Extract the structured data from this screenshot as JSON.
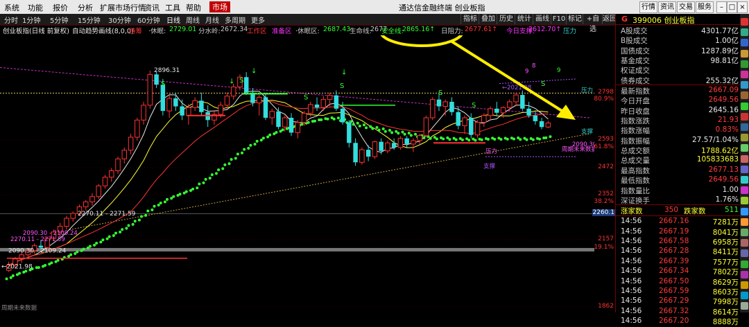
{
  "menu": {
    "items": [
      "系统",
      "功能",
      "报价",
      "分析",
      "扩展市场行情",
      "资讯",
      "工具",
      "帮助"
    ],
    "active": "市场",
    "title": "通达信金融终端  创业板指",
    "right": [
      "行情",
      "资讯",
      "交易",
      "服务"
    ]
  },
  "periods": [
    "分时",
    "1分钟",
    "5分钟",
    "15分钟",
    "30分钟",
    "60分钟",
    "日线",
    "周线",
    "月线",
    "多周期",
    "更多"
  ],
  "selected_period": "日线",
  "toolbar_right": [
    "指标",
    "叠加",
    "历史",
    "统计",
    "画线",
    "F10",
    "标记",
    "+自选",
    "返回"
  ],
  "legend": {
    "name": "创业板指(日线 前复权)",
    "auto": "自动趋势画线(8,0,0)",
    "items": [
      {
        "t": "持筹",
        "c": "#ff3333"
      },
      {
        "t": "·休眠:",
        "c": "#c8c8c8"
      },
      {
        "t": "2729.01",
        "c": "#33ff33"
      },
      {
        "t": "分水岭:",
        "c": "#c8c8c8"
      },
      {
        "t": "2672.34",
        "c": "#c8c8c8"
      },
      {
        "t": "工作区",
        "c": "#ff3333"
      },
      {
        "t": "准备区",
        "c": "#ff33ff"
      },
      {
        "t": "·休眠区:",
        "c": "#c8c8c8"
      },
      {
        "t": "2687.43",
        "c": "#33ff33"
      },
      {
        "t": "生命线:",
        "c": "#c8c8c8"
      },
      {
        "t": "2677",
        "c": "#c8c8c8"
      },
      {
        "t": "安全线:",
        "c": "#33ff33"
      },
      {
        "t": "2865.16↑",
        "c": "#33ff33"
      },
      {
        "t": "日阻力:",
        "c": "#c8c8c8"
      },
      {
        "t": "2677.61↑",
        "c": "#ff3333"
      },
      {
        "t": "今日支撑:",
        "c": "#ff33ff"
      },
      {
        "t": "2612.70↑",
        "c": "#ff33ff"
      },
      {
        "t": "压力",
        "c": "#33cccc"
      }
    ]
  },
  "chart_data": {
    "type": "candlestick",
    "ylim": [
      1862,
      2960
    ],
    "ticks": [
      2798,
      2593,
      2472,
      2352,
      2157,
      1862
    ],
    "pct_ticks": [
      "80.9%",
      "61.8%",
      "38.2%",
      "19.1%"
    ],
    "annotations": [
      "2896.31",
      "2270.11 - 2271.59",
      "2090.30 - 2109.24",
      "←2021.98",
      "2260.1",
      "周期未来数据",
      "压力",
      "支撑",
      "8",
      "9",
      "7",
      "5",
      "6",
      "3",
      "2",
      "1"
    ],
    "ohlc": [
      [
        2021.98,
        2060,
        2015,
        2045
      ],
      [
        2045,
        2080,
        2030,
        2072
      ],
      [
        2072,
        2100,
        2055,
        2090
      ],
      [
        2090,
        2118,
        2070,
        2108
      ],
      [
        2108,
        2140,
        2095,
        2130
      ],
      [
        2130,
        2155,
        2110,
        2122
      ],
      [
        2122,
        2170,
        2115,
        2162
      ],
      [
        2162,
        2200,
        2150,
        2190
      ],
      [
        2190,
        2230,
        2170,
        2215
      ],
      [
        2215,
        2260,
        2200,
        2250
      ],
      [
        2250,
        2280,
        2235,
        2271.59
      ],
      [
        2271,
        2310,
        2260,
        2300
      ],
      [
        2300,
        2330,
        2285,
        2322
      ],
      [
        2322,
        2360,
        2305,
        2345
      ],
      [
        2345,
        2400,
        2335,
        2392
      ],
      [
        2392,
        2440,
        2380,
        2430
      ],
      [
        2430,
        2470,
        2410,
        2458
      ],
      [
        2458,
        2520,
        2445,
        2510
      ],
      [
        2510,
        2560,
        2490,
        2548
      ],
      [
        2548,
        2620,
        2530,
        2605
      ],
      [
        2605,
        2690,
        2590,
        2680
      ],
      [
        2680,
        2760,
        2660,
        2745
      ],
      [
        2745,
        2896.31,
        2730,
        2880
      ],
      [
        2880,
        2890,
        2820,
        2835
      ],
      [
        2835,
        2860,
        2700,
        2720
      ],
      [
        2720,
        2790,
        2690,
        2775
      ],
      [
        2775,
        2800,
        2720,
        2740
      ],
      [
        2740,
        2770,
        2680,
        2700
      ],
      [
        2700,
        2750,
        2660,
        2735
      ],
      [
        2735,
        2780,
        2720,
        2765
      ],
      [
        2765,
        2800,
        2700,
        2715
      ],
      [
        2715,
        2745,
        2650,
        2680
      ],
      [
        2680,
        2720,
        2660,
        2705
      ],
      [
        2705,
        2760,
        2690,
        2745
      ],
      [
        2745,
        2800,
        2730,
        2785
      ],
      [
        2785,
        2840,
        2770,
        2825
      ],
      [
        2825,
        2880,
        2810,
        2868
      ],
      [
        2868,
        2890,
        2790,
        2800
      ],
      [
        2800,
        2820,
        2740,
        2755
      ],
      [
        2755,
        2790,
        2700,
        2780
      ],
      [
        2780,
        2800,
        2680,
        2690
      ],
      [
        2690,
        2730,
        2660,
        2718
      ],
      [
        2718,
        2735,
        2640,
        2650
      ],
      [
        2650,
        2700,
        2630,
        2690
      ],
      [
        2690,
        2710,
        2610,
        2625
      ],
      [
        2625,
        2680,
        2600,
        2670
      ],
      [
        2670,
        2720,
        2655,
        2710
      ],
      [
        2710,
        2760,
        2695,
        2748
      ],
      [
        2748,
        2780,
        2720,
        2735
      ],
      [
        2735,
        2785,
        2720,
        2770
      ],
      [
        2770,
        2800,
        2740,
        2788
      ],
      [
        2788,
        2810,
        2720,
        2730
      ],
      [
        2730,
        2760,
        2660,
        2670
      ],
      [
        2670,
        2680,
        2560,
        2580
      ],
      [
        2580,
        2600,
        2480,
        2495
      ],
      [
        2495,
        2560,
        2485,
        2550
      ],
      [
        2550,
        2570,
        2500,
        2520
      ],
      [
        2520,
        2590,
        2510,
        2585
      ],
      [
        2585,
        2600,
        2530,
        2545
      ],
      [
        2545,
        2590,
        2535,
        2580
      ],
      [
        2580,
        2600,
        2550,
        2560
      ],
      [
        2560,
        2610,
        2550,
        2600
      ],
      [
        2600,
        2610,
        2560,
        2575
      ],
      [
        2575,
        2600,
        2540,
        2590
      ],
      [
        2590,
        2620,
        2575,
        2612
      ],
      [
        2612,
        2700,
        2605,
        2690
      ],
      [
        2690,
        2780,
        2680,
        2770
      ],
      [
        2770,
        2800,
        2720,
        2740
      ],
      [
        2740,
        2770,
        2700,
        2760
      ],
      [
        2760,
        2780,
        2700,
        2715
      ],
      [
        2715,
        2740,
        2640,
        2655
      ],
      [
        2655,
        2700,
        2620,
        2690
      ],
      [
        2690,
        2710,
        2600,
        2615
      ],
      [
        2615,
        2680,
        2600,
        2670
      ],
      [
        2670,
        2710,
        2650,
        2700
      ],
      [
        2700,
        2740,
        2680,
        2730
      ],
      [
        2730,
        2760,
        2700,
        2712
      ],
      [
        2712,
        2740,
        2690,
        2735
      ],
      [
        2735,
        2770,
        2720,
        2760
      ],
      [
        2760,
        2800,
        2740,
        2790
      ],
      [
        2790,
        2810,
        2720,
        2730
      ],
      [
        2730,
        2760,
        2690,
        2700
      ],
      [
        2700,
        2720,
        2660,
        2675
      ],
      [
        2675,
        2690,
        2640,
        2649.56
      ],
      [
        2649.56,
        2677.13,
        2645,
        2667.09
      ]
    ]
  },
  "side": {
    "code": "G",
    "title": "399006 创业板指",
    "rows": [
      {
        "l": "A股成交",
        "v": "4301.77亿",
        "c": "#e8e8e8"
      },
      {
        "l": "B股成交",
        "v": "1.00亿",
        "c": "#e8e8e8"
      },
      {
        "l": "国债成交",
        "v": "1287.89亿",
        "c": "#e8e8e8"
      },
      {
        "l": "基金成交",
        "v": "98.81亿",
        "c": "#e8e8e8"
      },
      {
        "l": "权证成交",
        "v": "",
        "c": "#e8e8e8"
      },
      {
        "l": "债券成交",
        "v": "255.32亿",
        "c": "#e8e8e8"
      },
      {
        "l": "最新指数",
        "v": "2667.09",
        "c": "#ff3b3b",
        "div": true
      },
      {
        "l": "今日开盘",
        "v": "2649.56",
        "c": "#ff3b3b"
      },
      {
        "l": "昨日收盘",
        "v": "2645.16",
        "c": "#e8e8e8"
      },
      {
        "l": "指数涨跌",
        "v": "21.93",
        "c": "#ff3b3b"
      },
      {
        "l": "指数涨幅",
        "v": "0.83%",
        "c": "#ff3b3b"
      },
      {
        "l": "指数振幅",
        "v": "27.57/1.04%",
        "c": "#e8e8e8"
      },
      {
        "l": "总成交额",
        "v": "1788.62亿",
        "c": "#ffff33"
      },
      {
        "l": "总成交量",
        "v": "105833683",
        "c": "#ffff33"
      },
      {
        "l": "最高指数",
        "v": "2677.13",
        "c": "#ff3b3b"
      },
      {
        "l": "最低指数",
        "v": "2649.56",
        "c": "#ff3b3b"
      },
      {
        "l": "指数量比",
        "v": "1.00",
        "c": "#e8e8e8"
      },
      {
        "l": "深证换手",
        "v": "1.76%",
        "c": "#e8e8e8"
      }
    ],
    "updown": {
      "up_label": "涨家数",
      "up": "350",
      "down_label": "跌家数",
      "down": "511"
    },
    "ticks": [
      [
        "14:56",
        "2667.16",
        "7281万"
      ],
      [
        "14:56",
        "2667.19",
        "8041万"
      ],
      [
        "14:56",
        "2667.58",
        "6958万"
      ],
      [
        "14:56",
        "2667.28",
        "8411万"
      ],
      [
        "14:56",
        "2667.39",
        "7577万"
      ],
      [
        "14:56",
        "2667.34",
        "7802万"
      ],
      [
        "14:56",
        "2667.50",
        "8629万"
      ],
      [
        "14:56",
        "2667.59",
        "8603万"
      ],
      [
        "14:56",
        "2667.29",
        "7998万"
      ],
      [
        "14:56",
        "2667.32",
        "8614万"
      ],
      [
        "14:56",
        "2667.20",
        "8888万"
      ]
    ]
  }
}
